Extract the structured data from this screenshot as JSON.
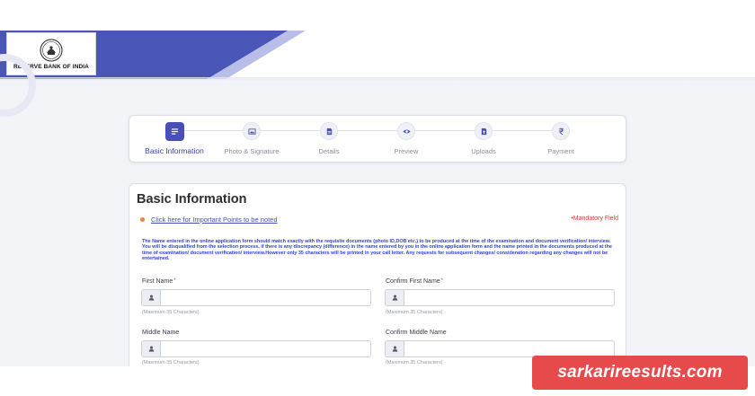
{
  "header": {
    "logo_text": "RESERVE BANK OF INDIA",
    "brand_color": "#4a55b8"
  },
  "stepper": {
    "steps": [
      {
        "label": "Basic Information",
        "icon": "list-icon",
        "active": true
      },
      {
        "label": "Photo & Signature",
        "icon": "image-icon",
        "active": false
      },
      {
        "label": "Details",
        "icon": "document-icon",
        "active": false
      },
      {
        "label": "Preview",
        "icon": "eye-icon",
        "active": false
      },
      {
        "label": "Uploads",
        "icon": "upload-file-icon",
        "active": false
      },
      {
        "label": "Payment",
        "icon": "rupee-icon",
        "active": false
      }
    ]
  },
  "form": {
    "title": "Basic Information",
    "important_link": "Click here for Important Points to be noted",
    "mandatory_note": "•Mandatory Field",
    "notice": "The Name entered in the online application form should match exactly with the requisite documents (photo ID,DOB etc.) to be produced at the time of the examination and document verification/ interview. You will be disqualified from the selection process, if there is any discrepancy (difference) in the name entered by you in the online application form and the name printed in the documents produced at the time of examination/ document verification/ interview.However only 35 characters will be printed in your call letter. Any requests for subsequent changes/ consideration regarding any changes will not be entertained.",
    "fields": {
      "first_name": {
        "label": "First Name",
        "required_mark": "*",
        "value": "",
        "hint": "(Maximum 35 Characters)"
      },
      "confirm_first_name": {
        "label": "Confirm First Name",
        "required_mark": "*",
        "value": "",
        "hint": "(Maximum 35 Characters)"
      },
      "middle_name": {
        "label": "Middle Name",
        "value": "",
        "hint": "(Maximum 35 Characters)"
      },
      "confirm_middle_name": {
        "label": "Confirm Middle Name",
        "value": "",
        "hint": "(Maximum 35 Characters)"
      }
    }
  },
  "watermark": {
    "text": "sarkarireesults.com",
    "color": "#e64a4a"
  }
}
